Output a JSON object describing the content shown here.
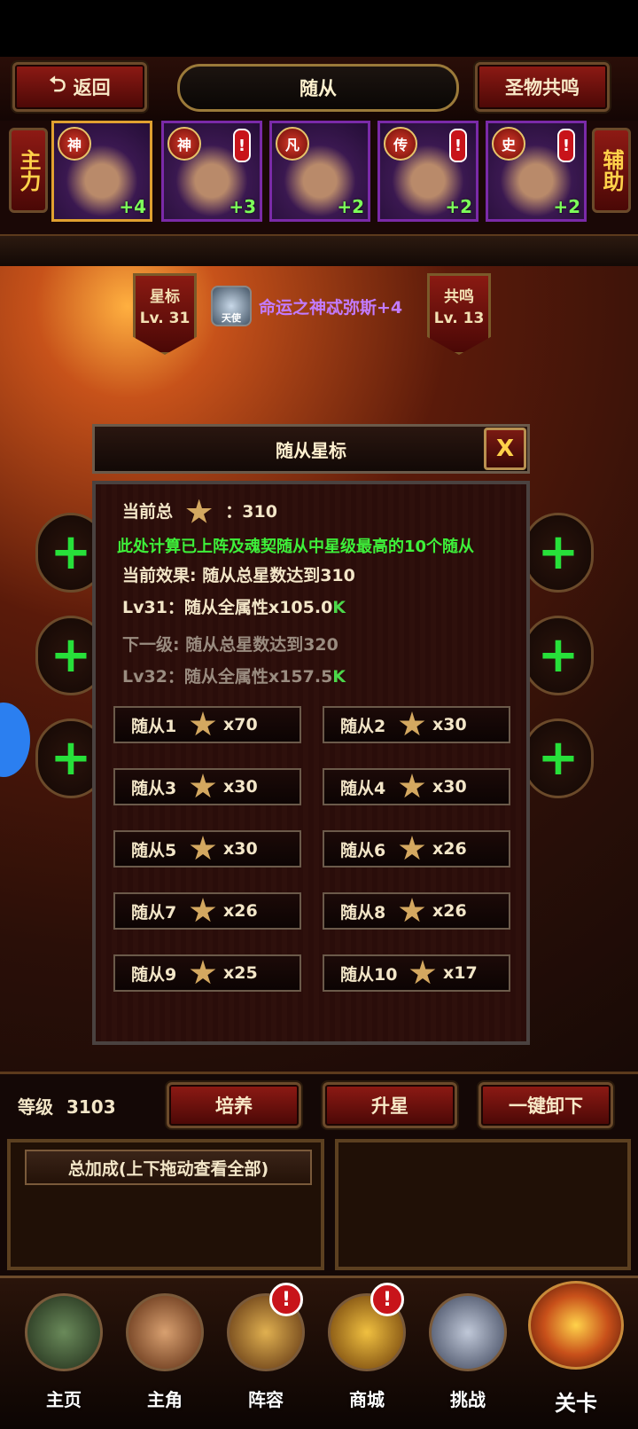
{
  "header": {
    "back_label": "返回",
    "title": "随从",
    "right_button": "圣物共鸣"
  },
  "side_tabs": {
    "left": "主力",
    "right": "辅助"
  },
  "heroes": [
    {
      "rank": "神",
      "plus": "+4",
      "selected": true,
      "alert": false
    },
    {
      "rank": "神",
      "plus": "+3",
      "selected": false,
      "alert": true
    },
    {
      "rank": "凡",
      "plus": "+2",
      "selected": false,
      "alert": false
    },
    {
      "rank": "传",
      "plus": "+2",
      "selected": false,
      "alert": true
    },
    {
      "rank": "史",
      "plus": "+2",
      "selected": false,
      "alert": true
    }
  ],
  "alert_glyph": "!",
  "star_marker": {
    "label": "星标",
    "level": "Lv. 31"
  },
  "resonance_marker": {
    "label": "共鸣",
    "level": "Lv. 13"
  },
  "skill": {
    "icon_label": "天使",
    "name": "命运之神忒弥斯+4"
  },
  "modal": {
    "title": "随从星标",
    "close_label": "X",
    "total_label": "当前总",
    "total_value": "：310",
    "note": "此处计算已上阵及魂契随从中星级最高的10个随从",
    "current_effect": "当前效果: 随从总星数达到310",
    "current_level_effect": "Lv31：随从全属性x105.0",
    "current_level_unit": "K",
    "next_level": "下一级: 随从总星数达到320",
    "next_level_effect": "Lv32：随从全属性x157.5",
    "next_level_unit": "K",
    "slots": [
      {
        "name": "随从1",
        "count": "x70"
      },
      {
        "name": "随从2",
        "count": "x30"
      },
      {
        "name": "随从3",
        "count": "x30"
      },
      {
        "name": "随从4",
        "count": "x30"
      },
      {
        "name": "随从5",
        "count": "x30"
      },
      {
        "name": "随从6",
        "count": "x26"
      },
      {
        "name": "随从7",
        "count": "x26"
      },
      {
        "name": "随从8",
        "count": "x26"
      },
      {
        "name": "随从9",
        "count": "x25"
      },
      {
        "name": "随从10",
        "count": "x17"
      }
    ]
  },
  "bottom": {
    "level_label": "等级",
    "level_value": "3103",
    "train_button": "培养",
    "star_up_button": "升星",
    "unequip_button": "一键卸下",
    "bonus_header": "总加成(上下拖动查看全部)"
  },
  "nav": [
    {
      "label": "主页",
      "icon": "castle-icon",
      "alert": false
    },
    {
      "label": "主角",
      "icon": "hero-portrait-icon",
      "alert": false
    },
    {
      "label": "阵容",
      "icon": "formation-icon",
      "alert": true
    },
    {
      "label": "商城",
      "icon": "treasure-chest-icon",
      "alert": true
    },
    {
      "label": "挑战",
      "icon": "crossed-axes-icon",
      "alert": false
    },
    {
      "label": "关卡",
      "icon": "stage-emblem-icon",
      "alert": false
    }
  ],
  "plus_glyph": "+"
}
